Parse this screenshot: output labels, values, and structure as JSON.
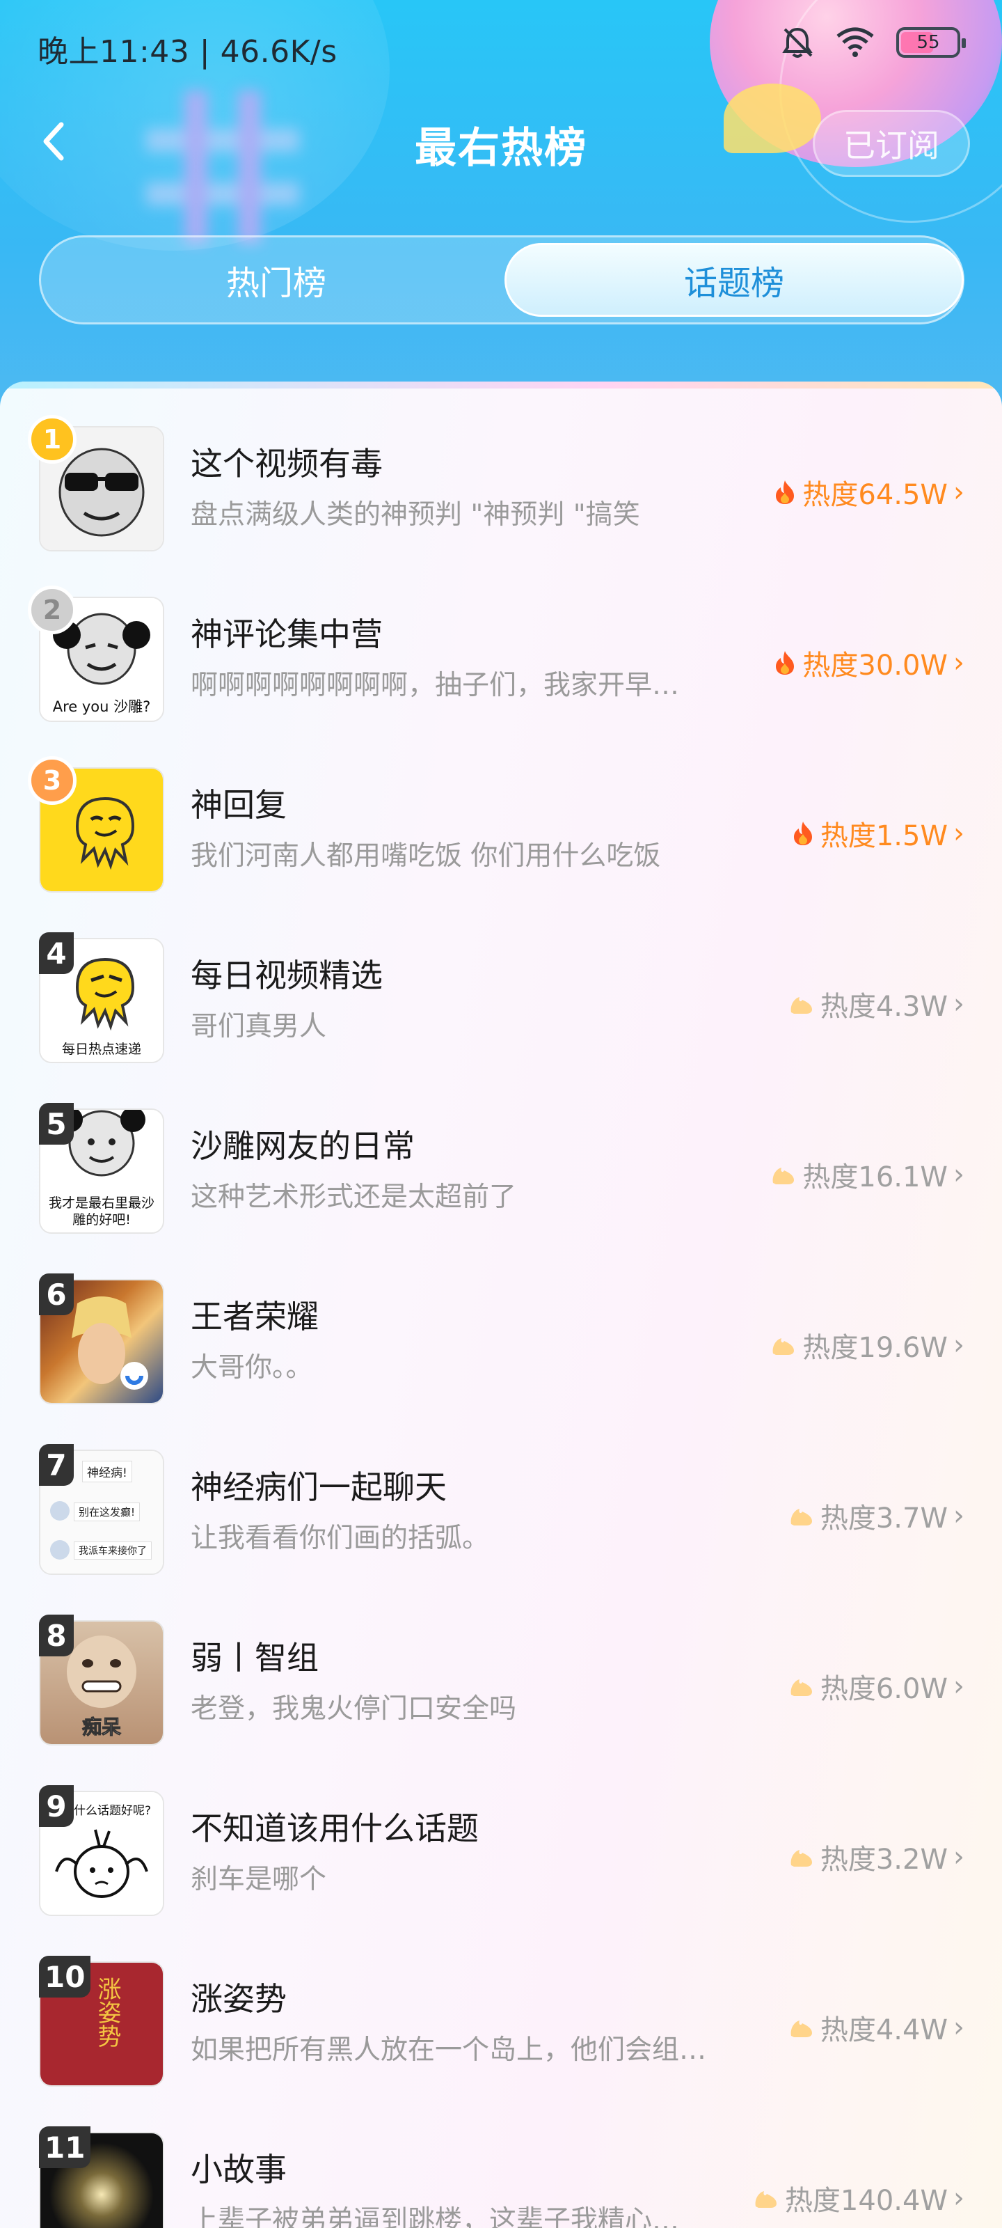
{
  "status_bar": {
    "time": "晚上11:43 | 46.6K/s",
    "battery": "55",
    "icons": [
      "bell-off-icon",
      "wifi-icon",
      "battery-icon"
    ]
  },
  "header": {
    "title": "最右热榜",
    "subscribe_label": "已订阅",
    "back_icon": "chevron-left-icon"
  },
  "tabs": [
    {
      "label": "热门榜",
      "selected": false
    },
    {
      "label": "话题榜",
      "selected": true
    }
  ],
  "colors": {
    "header_blue": "#28c6f7",
    "hot_orange": "#ff8a1f",
    "muted_gray": "#a0a0a0",
    "tab_active_text": "#1e8fd9"
  },
  "items": [
    {
      "rank": "1",
      "title": "这个视频有毒",
      "desc": "盘点满级人类的神预判 \"神预判 \"搞笑",
      "heat": "热度64.5W",
      "hot": true
    },
    {
      "rank": "2",
      "title": "神评论集中营",
      "desc": "啊啊啊啊啊啊啊啊，抽子们，我家开早…",
      "heat": "热度30.0W",
      "hot": true,
      "thumb_text": "Are you 沙雕?"
    },
    {
      "rank": "3",
      "title": "神回复",
      "desc": "我们河南人都用嘴吃饭 你们用什么吃饭",
      "heat": "热度1.5W",
      "hot": true
    },
    {
      "rank": "4",
      "title": "每日视频精选",
      "desc": "哥们真男人",
      "heat": "热度4.3W",
      "hot": false,
      "thumb_text": "每日热点速递"
    },
    {
      "rank": "5",
      "title": "沙雕网友的日常",
      "desc": "这种艺术形式还是太超前了",
      "heat": "热度16.1W",
      "hot": false,
      "thumb_text": "我才是最右里最沙雕的好吧!"
    },
    {
      "rank": "6",
      "title": "王者荣耀",
      "desc": "大哥你。。",
      "heat": "热度19.6W",
      "hot": false
    },
    {
      "rank": "7",
      "title": "神经病们一起聊天",
      "desc": "让我看看你们画的括弧。",
      "heat": "热度3.7W",
      "hot": false,
      "thumb_lines": [
        "神经病!",
        "别在这发癫!",
        "我派车来接你了"
      ]
    },
    {
      "rank": "8",
      "title": "弱丨智组",
      "desc": "老登，我鬼火停门口安全吗",
      "heat": "热度6.0W",
      "hot": false,
      "thumb_text": "痴呆"
    },
    {
      "rank": "9",
      "title": "不知道该用什么话题",
      "desc": "刹车是哪个",
      "heat": "热度3.2W",
      "hot": false,
      "thumb_text": "该用什么话题好呢?"
    },
    {
      "rank": "10",
      "title": "涨姿势",
      "desc": "如果把所有黑人放在一个岛上，他们会组…",
      "heat": "热度4.4W",
      "hot": false,
      "thumb_text": "涨姿势"
    },
    {
      "rank": "11",
      "title": "小故事",
      "desc": "上辈子被弟弟逼到跳楼，这辈子我精心…",
      "heat": "热度140.4W",
      "hot": false
    }
  ]
}
